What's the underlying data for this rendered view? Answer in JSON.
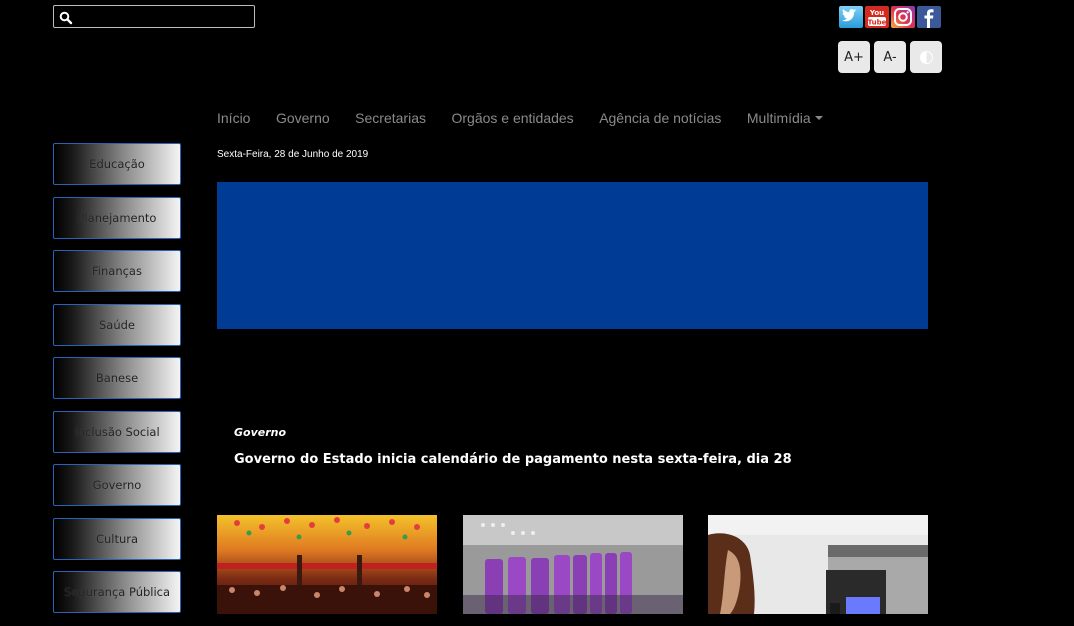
{
  "search": {
    "placeholder": "",
    "value": "",
    "icon": "search-icon"
  },
  "social": [
    {
      "name": "twitter",
      "icon": "twitter-icon",
      "color": "#2a9bd8"
    },
    {
      "name": "youtube",
      "icon": "youtube-icon",
      "color": "#d42a1f"
    },
    {
      "name": "instagram",
      "icon": "instagram-icon",
      "color": "#c13584"
    },
    {
      "name": "facebook",
      "icon": "facebook-icon",
      "color": "#3b5998"
    }
  ],
  "accessibility": {
    "increase_label": "A+",
    "decrease_label": "A-",
    "contrast_icon": "contrast-icon"
  },
  "nav": {
    "items": [
      "Início",
      "Governo",
      "Secretarias",
      "Orgãos e entidades",
      "Agência de notícias",
      "Multimídia"
    ]
  },
  "sidebar": {
    "items": [
      "Educação",
      "Planejamento",
      "Finanças",
      "Saúde",
      "Banese",
      "Inclusão Social",
      "Governo",
      "Cultura",
      "Segurança Pública"
    ]
  },
  "date": "Sexta-Feira, 28 de Junho de 2019",
  "banner": {
    "color": "#003c96"
  },
  "news": {
    "category": "Governo",
    "title": "Governo do Estado inicia calendário de pagamento nesta sexta-feira, dia 28"
  }
}
